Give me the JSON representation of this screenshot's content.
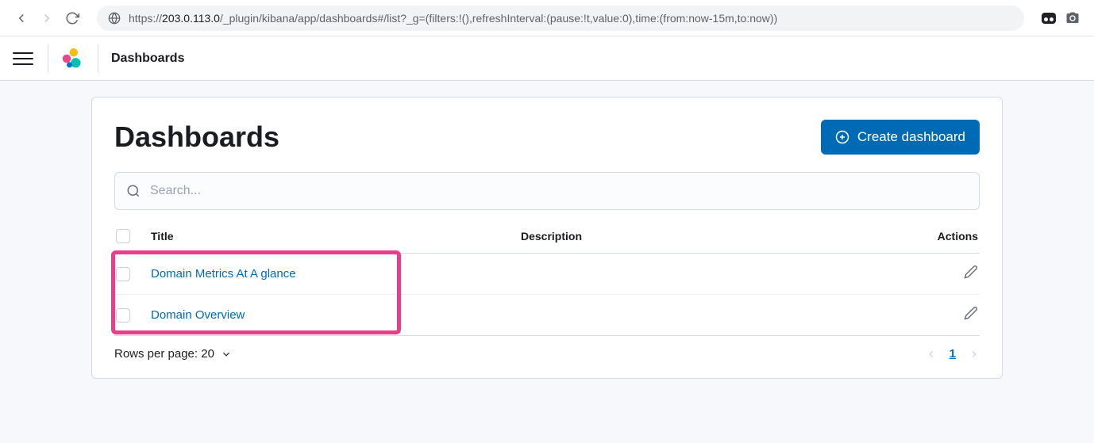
{
  "browser": {
    "url_prefix": "https://",
    "url_bold": "203.0.113.0",
    "url_suffix": "/_plugin/kibana/app/dashboards#/list?_g=(filters:!(),refreshInterval:(pause:!t,value:0),time:(from:now-15m,to:now))"
  },
  "header": {
    "breadcrumb": "Dashboards"
  },
  "page": {
    "title": "Dashboards",
    "create_button": "Create dashboard",
    "search_placeholder": "Search..."
  },
  "table": {
    "columns": {
      "title": "Title",
      "description": "Description",
      "actions": "Actions"
    },
    "rows": [
      {
        "title": "Domain Metrics At A glance",
        "description": ""
      },
      {
        "title": "Domain Overview",
        "description": ""
      }
    ]
  },
  "footer": {
    "rows_per_page_label": "Rows per page: 20",
    "current_page": "1"
  }
}
